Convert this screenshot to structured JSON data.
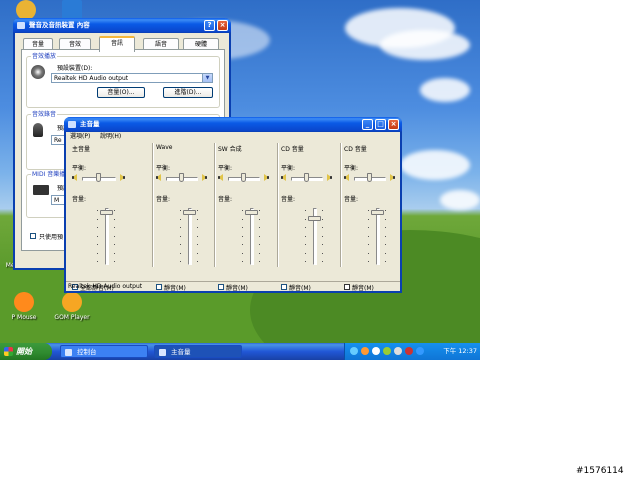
{
  "desktop": {
    "icons": [
      {
        "label": "",
        "color": "#e9b334"
      },
      {
        "label": "",
        "color": "#2a7bd6"
      },
      {
        "label": "P Mouse",
        "color": "#ff8a1c"
      },
      {
        "label": "GOM Player",
        "color": "#f6a623"
      },
      {
        "label": "Media Fi",
        "color": "#2f6ec7"
      }
    ]
  },
  "props_window": {
    "title": "聲音及音訊裝置 內容",
    "help_btn": "?",
    "close_btn": "×",
    "tabs": [
      "音量",
      "音效",
      "音訊",
      "語音",
      "硬體"
    ],
    "active_tab": 2,
    "playback_group": "音效播放",
    "playback_device_label": "預設裝置(D):",
    "playback_device_value": "Realtek HD Audio output",
    "volume_button": "音量(O)...",
    "advanced_button": "進階(D)...",
    "record_group": "音效錄音",
    "record_device_label": "預設裝置",
    "record_device_value": "Re",
    "midi_group": "MIDI 音樂播放",
    "midi_device_label": "預設裝",
    "midi_device_value": "M",
    "default_only_label": "只使用預"
  },
  "mixer": {
    "title": "主音量",
    "menu": [
      "選項(P)",
      "說明(H)"
    ],
    "balance_label": "平衡:",
    "volume_label": "音量:",
    "channels": [
      {
        "name": "主音量",
        "mute_label": "全部靜音(M)",
        "balance": 0.5,
        "volume": 0.08,
        "muted": false
      },
      {
        "name": "Wave",
        "mute_label": "靜音(M)",
        "balance": 0.5,
        "volume": 0.08,
        "muted": false
      },
      {
        "name": "SW 合成",
        "mute_label": "靜音(M)",
        "balance": 0.5,
        "volume": 0.08,
        "muted": false
      },
      {
        "name": "CD 音量",
        "mute_label": "靜音(M)",
        "balance": 0.5,
        "volume": 0.18,
        "muted": false
      },
      {
        "name": "CD 音量",
        "mute_label": "靜音(M)",
        "balance": 0.5,
        "volume": 0.08,
        "muted": true
      }
    ],
    "status": "Realtek HD Audio output"
  },
  "taskbar": {
    "start_label": "開始",
    "tasks": [
      "控制台",
      "主音量"
    ],
    "active_task": 1,
    "clock": "下午 12:37"
  },
  "watermark": "#1576114"
}
